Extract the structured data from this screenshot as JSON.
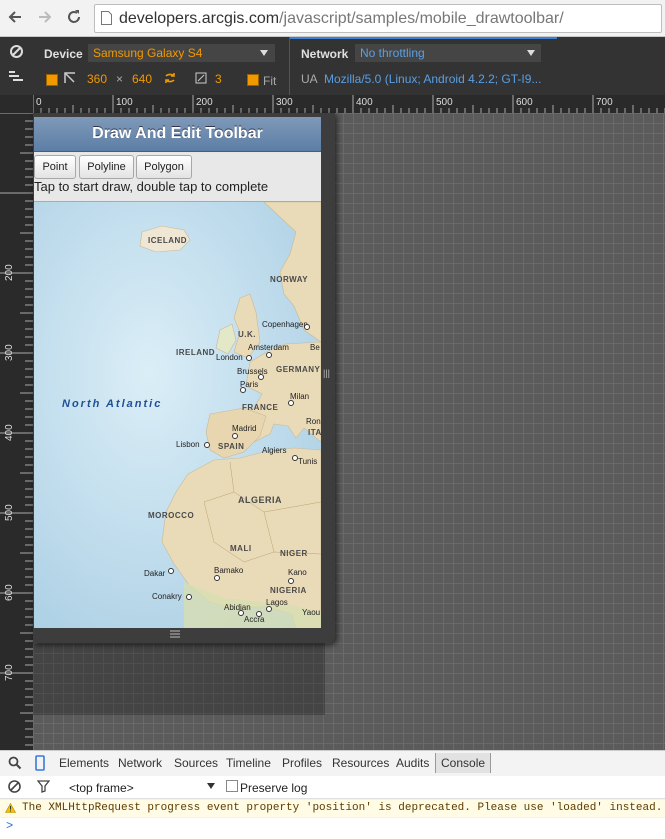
{
  "browser": {
    "url_host": "developers.arcgis.com",
    "url_path": "/javascript/samples/mobile_drawtoolbar/"
  },
  "devtools_toolbar": {
    "device_label": "Device",
    "device_value": "Samsung Galaxy S4",
    "network_label": "Network",
    "network_value": "No throttling",
    "width": "360",
    "times": "×",
    "height": "640",
    "scale": "3",
    "fit_label": "Fit",
    "ua_label": "UA",
    "ua_value": "Mozilla/5.0 (Linux; Android 4.2.2; GT-I9..."
  },
  "rulers": {
    "horizontal": [
      "0",
      "100",
      "200",
      "300",
      "400",
      "500",
      "600",
      "700"
    ],
    "vertical": [
      "200",
      "300",
      "400",
      "500",
      "600",
      "700"
    ]
  },
  "app": {
    "title": "Draw And Edit Toolbar",
    "buttons": [
      "Point",
      "Polyline",
      "Polygon"
    ],
    "instruction": "Tap to start draw, double tap to complete"
  },
  "map": {
    "ocean_label": "North Atlantic",
    "countries": [
      "ICELAND",
      "NORWAY",
      "U.K.",
      "IRELAND",
      "GERMANY",
      "FRANCE",
      "SPAIN",
      "ALGERIA",
      "MOROCCO",
      "MALI",
      "NIGER",
      "NIGERIA",
      "ITA"
    ],
    "cities": [
      "Copenhagen",
      "London",
      "Amsterdam",
      "Brussels",
      "Paris",
      "Milan",
      "Madrid",
      "Lisbon",
      "Algiers",
      "Tunis",
      "Dakar",
      "Bamako",
      "Kano",
      "Conakry",
      "Abidjan",
      "Lagos",
      "Accra",
      "Yaou",
      "Be",
      "Ron"
    ],
    "colors": {
      "ocean": "#b9d8ea",
      "land": "#eadbb8"
    }
  },
  "devtools_panel": {
    "tabs": [
      "Elements",
      "Network",
      "Sources",
      "Timeline",
      "Profiles",
      "Resources",
      "Audits",
      "Console"
    ],
    "active_tab": "Console",
    "frame_select": "<top frame>",
    "preserve_log": "Preserve log",
    "warning": "The XMLHttpRequest progress event property 'position' is deprecated. Please use 'loaded' instead.",
    "prompt": ">"
  }
}
